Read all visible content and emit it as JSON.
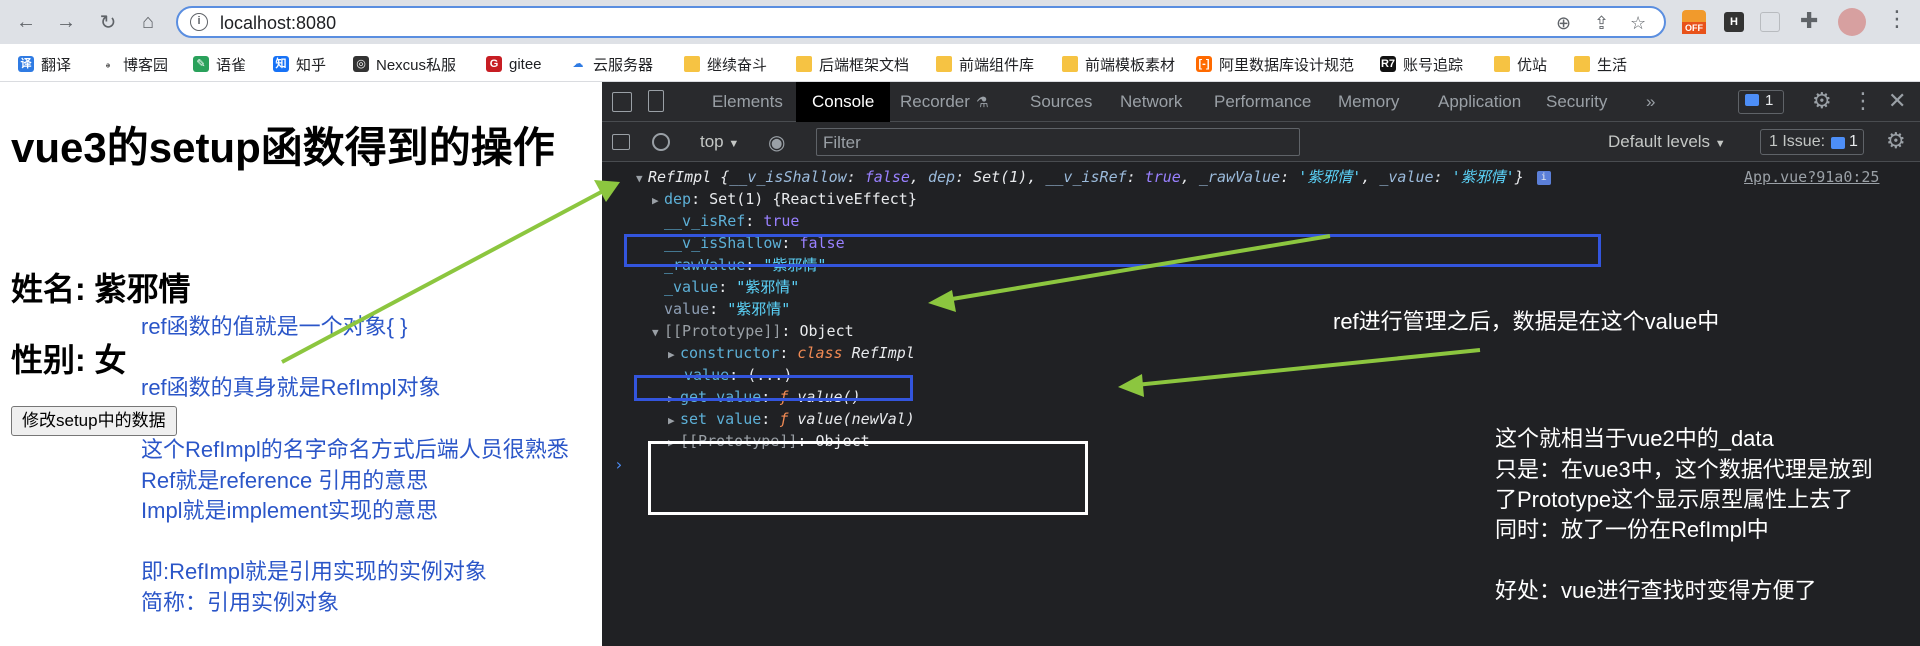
{
  "browser": {
    "url": "localhost:8080",
    "bookmarks": [
      "翻译",
      "博客园",
      "语雀",
      "知乎",
      "Nexcus私服",
      "gitee",
      "云服务器",
      "继续奋斗",
      "后端框架文档",
      "前端组件库",
      "前端模板素材",
      "阿里数据库设计规范",
      "账号追踪",
      "优站",
      "生活"
    ],
    "extension_badge": "OFF"
  },
  "page": {
    "title": "vue3的setup函数得到的操作",
    "name_label": "姓名: 紫邪情",
    "gender_label": "性别: 女",
    "button_label": "修改setup中的数据",
    "annotations": {
      "a1": "ref函数的值就是一个对象{ }",
      "a2": "ref函数的真身就是RefImpl对象",
      "a3": "这个RefImpl的名字命名方式后端人员很熟悉",
      "a4": "Ref就是reference 引用的意思",
      "a5": "Impl就是implement实现的意思",
      "a6": "即:RefImpl就是引用实现的实例对象",
      "a7": "简称：引用实例对象"
    }
  },
  "devtools": {
    "tabs": [
      "Elements",
      "Console",
      "Recorder",
      "Sources",
      "Network",
      "Performance",
      "Memory",
      "Application",
      "Security"
    ],
    "active_tab": "Console",
    "issues_badge": "1",
    "context": "top",
    "filter_placeholder": "Filter",
    "levels": "Default levels",
    "issue_count": "1 Issue:",
    "issue_num": "1",
    "source_link": "App.vue?91a0:25",
    "console": {
      "line1": {
        "head": "RefImpl {",
        "k1": "__v_isShallow",
        "v1": "false",
        "k2": "dep",
        "v2": "Set(1)",
        "k3": "__v_isRef",
        "v3": "true",
        "k4": "_rawValue",
        "v4": "'紫邪情'",
        "k5": "_value",
        "v5": "'紫邪情'",
        "tail": "}"
      },
      "dep_key": "dep",
      "dep_val": "Set(1) {ReactiveEffect}",
      "isref_key": "__v_isRef",
      "isref_val": "true",
      "isshallow_key": "__v_isShallow",
      "isshallow_val": "false",
      "raw_key": "_rawValue",
      "raw_val": "\"紫邪情\"",
      "value_key": "_value",
      "value_val": "\"紫邪情\"",
      "val_key": "value",
      "val_val": "\"紫邪情\"",
      "proto_key": "[[Prototype]]",
      "proto_val": "Object",
      "ctor_key": "constructor",
      "ctor_kw": "class",
      "ctor_val": "RefImpl",
      "pv_key": "value",
      "pv_val": "(...)",
      "get_key": "get value",
      "get_val": "value()",
      "set_key": "set value",
      "set_val": "value(newVal)",
      "proto2_key": "[[Prototype]]",
      "proto2_val": "Object",
      "fn_symbol": "ƒ"
    },
    "annotations": {
      "b1": "ref进行管理之后，数据是在这个value中",
      "b2": "这个就相当于vue2中的_data",
      "b3": "只是：在vue3中，这个数据代理是放到",
      "b4": "了Prototype这个显示原型属性上去了",
      "b5": "同时：放了一份在RefImpl中",
      "b6": "好处：vue进行查找时变得方便了"
    }
  },
  "colors": {
    "annotation_blue": "#2b56c8",
    "box_blue": "#3355dd",
    "box_white": "#ffffff",
    "arrow_green": "#8cc63f"
  }
}
